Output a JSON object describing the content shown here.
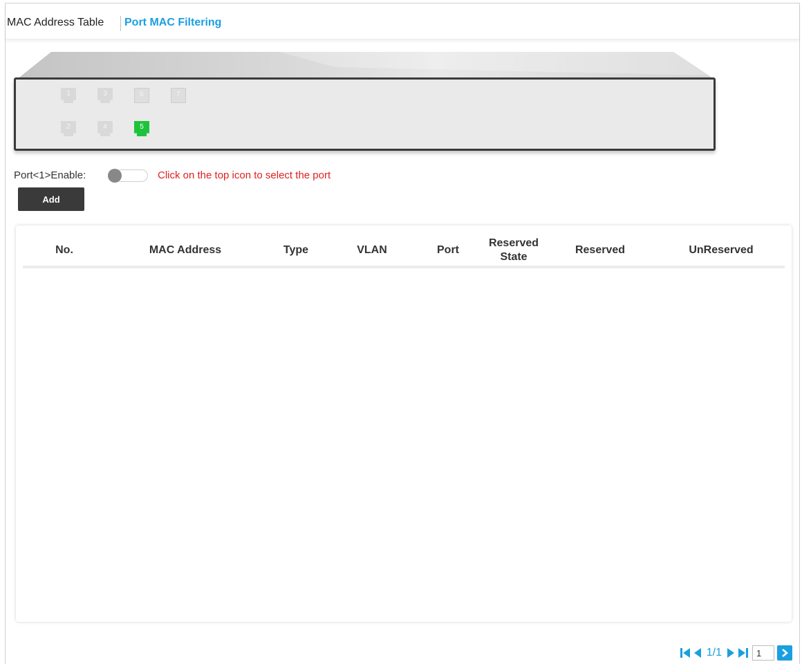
{
  "tabs": [
    {
      "label": "MAC Address Table",
      "active": false
    },
    {
      "label": "Port MAC Filtering",
      "active": true
    }
  ],
  "ports": {
    "top_row": [
      "1",
      "3",
      "6",
      "7"
    ],
    "bottom_row": [
      "2",
      "4",
      "5"
    ],
    "selected": "5",
    "active_color": "#1ec33b"
  },
  "enable": {
    "label": "Port<1>Enable:",
    "toggle_state": "off",
    "hint": "Click on the top icon to select the port"
  },
  "add_button": {
    "label": "Add"
  },
  "table": {
    "headers": {
      "no": "No.",
      "mac": "MAC Address",
      "type": "Type",
      "vlan": "VLAN",
      "port": "Port",
      "reserved_state": "Reserved State",
      "reserved": "Reserved",
      "unreserved": "UnReserved"
    },
    "rows": []
  },
  "pagination": {
    "page_text": "1/1",
    "page_input": "1"
  },
  "colors": {
    "accent": "#1a9fe0",
    "hint": "#e02020",
    "button": "#3a3a3a"
  }
}
